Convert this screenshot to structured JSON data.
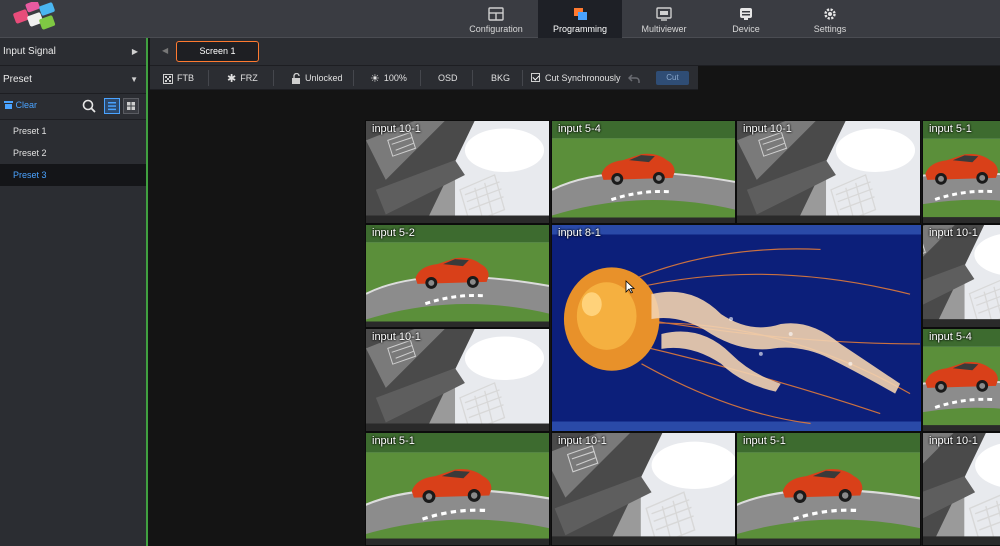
{
  "nav": {
    "tabs": [
      {
        "label": "Configuration",
        "icon": "configuration-icon"
      },
      {
        "label": "Programming",
        "icon": "programming-icon",
        "active": true
      },
      {
        "label": "Multiviewer",
        "icon": "multiviewer-icon"
      },
      {
        "label": "Device",
        "icon": "device-icon"
      },
      {
        "label": "Settings",
        "icon": "gear-icon"
      }
    ]
  },
  "sidebar": {
    "input_signal": "Input Signal",
    "preset": "Preset",
    "clear": "Clear",
    "presets": [
      "Preset 1",
      "Preset 2",
      "Preset 3"
    ],
    "selected_preset": "Preset 3"
  },
  "screen_tab": "Screen 1",
  "toolbar": {
    "ftb": "FTB",
    "frz": "FRZ",
    "lock": "Unlocked",
    "brightness": "100%",
    "osd": "OSD",
    "bkg": "BKG",
    "cut_sync": "Cut Synchronously",
    "cut_sync_checked": true,
    "cut": "Cut"
  },
  "windows": [
    {
      "label": "input 10-1",
      "source": "construction"
    },
    {
      "label": "input 5-4",
      "source": "racecar"
    },
    {
      "label": "input 10-1",
      "source": "construction"
    },
    {
      "label": "input 5-1",
      "source": "racecar"
    },
    {
      "label": "input 5-2",
      "source": "racecar"
    },
    {
      "label": "input 8-1",
      "source": "jellyfish"
    },
    {
      "label": "input 10-1",
      "source": "construction"
    },
    {
      "label": "input 10-1",
      "source": "construction"
    },
    {
      "label": "input 5-4",
      "source": "racecar"
    },
    {
      "label": "input 5-1",
      "source": "racecar"
    },
    {
      "label": "input 10-1",
      "source": "construction"
    },
    {
      "label": "input 5-1",
      "source": "racecar"
    },
    {
      "label": "input 10-1",
      "source": "construction"
    }
  ],
  "colors": {
    "accent": "#4aa3ff",
    "active_tab": "#ff7a30",
    "border_green": "#40a040"
  }
}
